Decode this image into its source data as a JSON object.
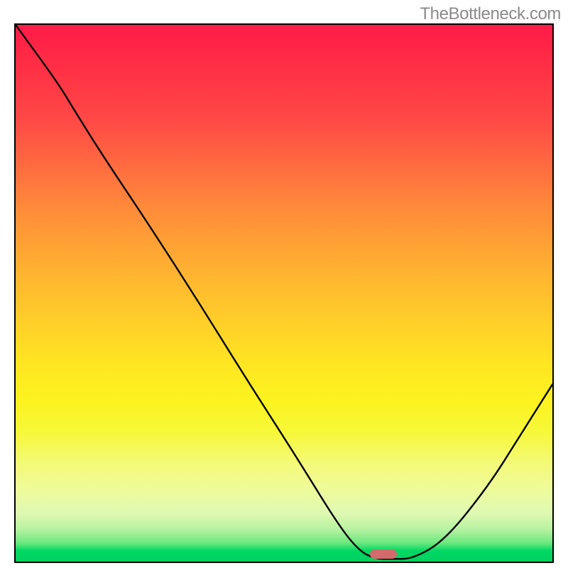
{
  "watermark": "TheBottleneck.com",
  "chart_data": {
    "type": "line",
    "title": "",
    "xlabel": "",
    "ylabel": "",
    "ylim": [
      0,
      100
    ],
    "axes_shown": false,
    "series": [
      {
        "name": "curve",
        "x": [
          0.0,
          0.08,
          0.11,
          0.16,
          0.25,
          0.34,
          0.43,
          0.52,
          0.6,
          0.64,
          0.67,
          0.7,
          0.74,
          0.8,
          0.88,
          0.94,
          1.0
        ],
        "values": [
          100,
          89,
          84,
          76,
          62.5,
          48.5,
          34,
          20,
          7,
          2,
          0.5,
          0.5,
          0.5,
          4,
          14,
          23.5,
          33
        ]
      }
    ],
    "gradient_stops": [
      {
        "pct": 0,
        "color": "#ff1b47"
      },
      {
        "pct": 18,
        "color": "#ff4a46"
      },
      {
        "pct": 34,
        "color": "#ff8a3a"
      },
      {
        "pct": 48,
        "color": "#ffb92f"
      },
      {
        "pct": 63,
        "color": "#ffe522"
      },
      {
        "pct": 82,
        "color": "#f4fa7a"
      },
      {
        "pct": 94,
        "color": "#b6f2a1"
      },
      {
        "pct": 100,
        "color": "#00d060"
      }
    ],
    "marker": {
      "x_center_frac": 0.685,
      "y_frac": 0.005,
      "width_frac": 0.05,
      "height_frac": 0.017,
      "color": "#d36a6b"
    }
  }
}
